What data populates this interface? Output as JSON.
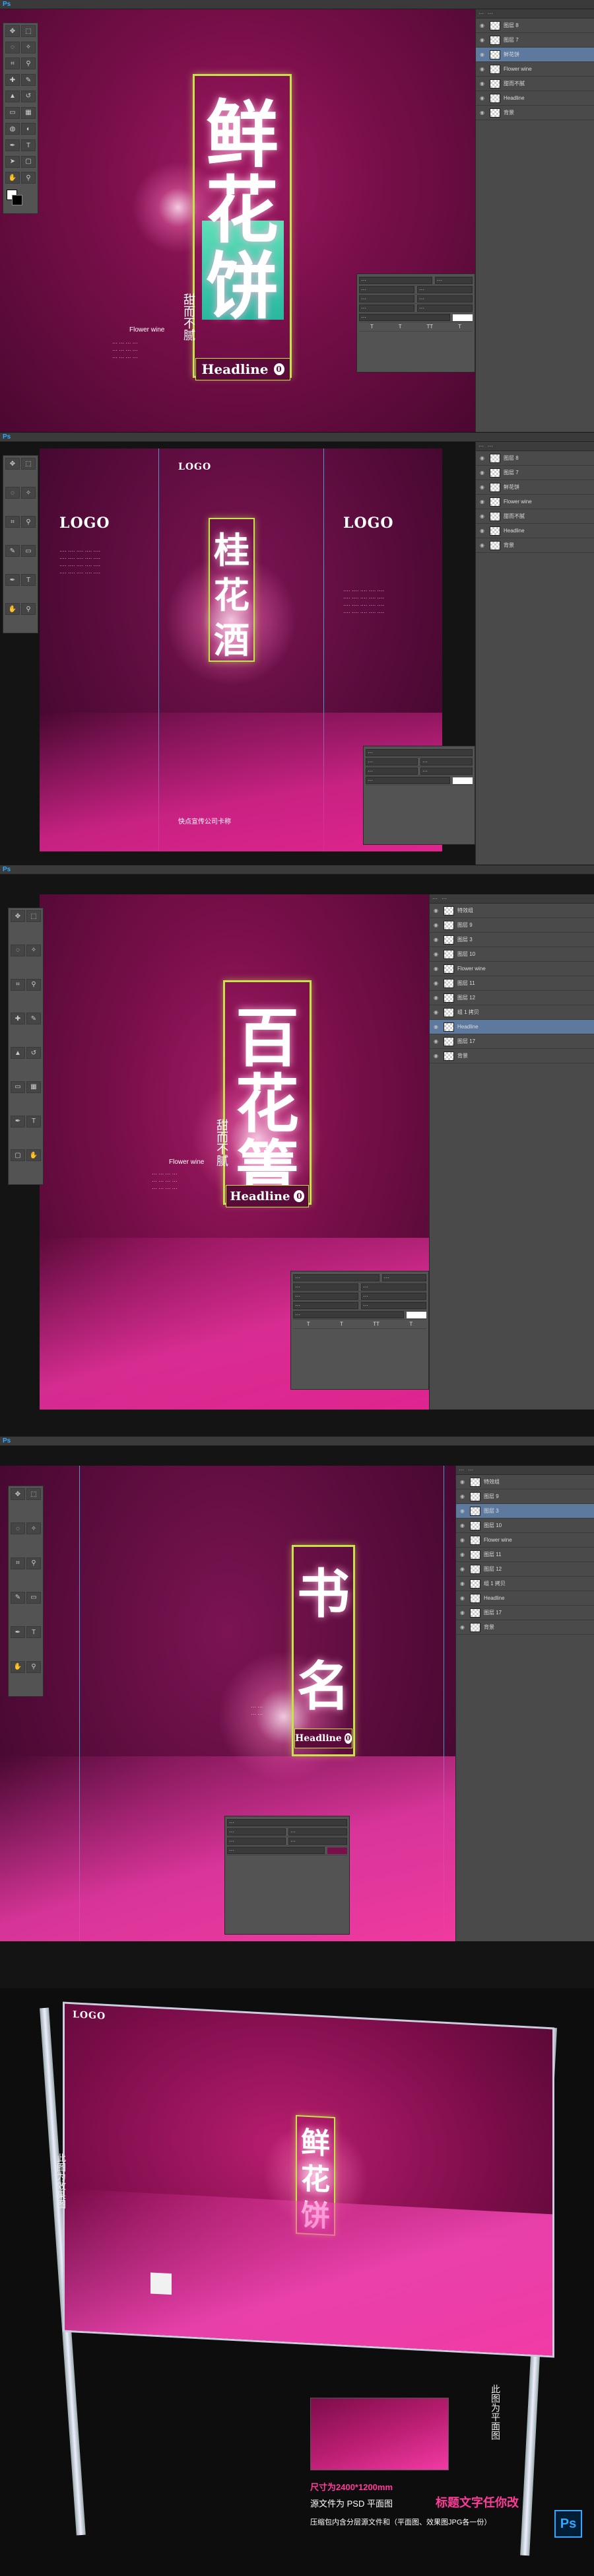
{
  "app": {
    "name": "Ps"
  },
  "panel1": {
    "title_chars": [
      "鲜",
      "花",
      "饼"
    ],
    "subtitle_vertical": "甜而不腻",
    "en_label": "Flower wine",
    "headline": "Headline",
    "badge": "0",
    "layers": [
      "图层 8",
      "图层 7",
      "鲜花饼",
      "Flower wine",
      "甜而不腻",
      "Headline",
      "背景"
    ]
  },
  "panel2": {
    "logos": [
      "LOGO",
      "LOGO",
      "LOGO"
    ],
    "title_chars": [
      "桂",
      "花",
      "酒"
    ],
    "footer": "快点宣传公司卡称"
  },
  "panel3": {
    "title_chars": [
      "百",
      "花",
      "箐"
    ],
    "subtitle_vertical": "甜而不腻",
    "en_label": "Flower wine",
    "headline": "Headline",
    "badge": "0",
    "layers": [
      "特效组",
      "图层 9",
      "图层 3",
      "图层 10",
      "Flower wine",
      "图层 11",
      "图层 12",
      "组 1 拷贝",
      "Headline",
      "图层 17",
      "背景"
    ]
  },
  "panel4": {
    "title_chars": [
      "书",
      "名"
    ],
    "headline": "Headline",
    "badge": "0"
  },
  "panel5": {
    "logo": "LOGO",
    "title_chars": [
      "鲜",
      "花",
      "饼"
    ],
    "side_label": "此图为效果图",
    "side_label2": "此图为平面图",
    "size_info": "尺寸为2400*1200mm",
    "title_note": "标题文字任你改",
    "source_note": "源文件为 PSD 平面图",
    "package_note": "压缩包内含分层源文件和（平面图、效果图JPG各一份）"
  },
  "colors": {
    "magenta": "#a01a63",
    "lime": "#c7e34a",
    "ps_blue": "#31a8ff",
    "pink": "#ff3b9a"
  }
}
